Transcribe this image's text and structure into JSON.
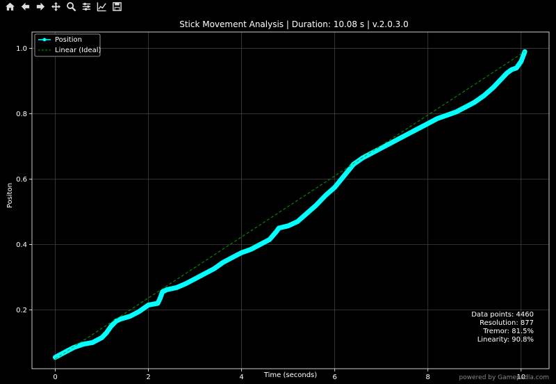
{
  "toolbar": {
    "buttons": [
      "home-icon",
      "back-icon",
      "forward-icon",
      "pan-icon",
      "zoom-icon",
      "configure-icon",
      "edit-axis-icon",
      "save-icon"
    ]
  },
  "chart_data": {
    "type": "line",
    "title": "Stick Movement Analysis | Duration: 10.08 s | v.2.0.3.0",
    "xlabel": "Time (seconds)",
    "ylabel": "Positon",
    "xlim": [
      -0.5,
      10.6
    ],
    "ylim": [
      0.02,
      1.05
    ],
    "xticks": [
      0,
      2,
      4,
      6,
      8,
      10
    ],
    "xtick_labels": [
      "0",
      "2",
      "4",
      "6",
      "8",
      "10"
    ],
    "yticks": [
      0.2,
      0.4,
      0.6,
      0.8,
      1.0
    ],
    "ytick_labels": [
      "0.2",
      "0.4",
      "0.6",
      "0.8",
      "1.0"
    ],
    "grid": true,
    "legend_position": "top-left",
    "series": [
      {
        "name": "Position",
        "color": "#00ffff",
        "style": "solid-with-markers",
        "x": [
          0,
          0.2,
          0.4,
          0.6,
          0.8,
          1.0,
          1.1,
          1.2,
          1.3,
          1.4,
          1.6,
          1.8,
          1.9,
          2.0,
          2.2,
          2.25,
          2.3,
          2.4,
          2.6,
          2.8,
          3.0,
          3.2,
          3.4,
          3.6,
          3.8,
          4.0,
          4.2,
          4.4,
          4.6,
          4.75,
          4.8,
          5.0,
          5.2,
          5.4,
          5.6,
          5.8,
          6.0,
          6.2,
          6.4,
          6.6,
          6.8,
          7.0,
          7.2,
          7.4,
          7.6,
          7.8,
          8.0,
          8.2,
          8.4,
          8.6,
          8.8,
          9.0,
          9.2,
          9.4,
          9.6,
          9.7,
          9.8,
          9.9,
          10.0,
          10.08
        ],
        "y": [
          0.055,
          0.07,
          0.085,
          0.095,
          0.1,
          0.115,
          0.13,
          0.15,
          0.165,
          0.172,
          0.18,
          0.195,
          0.205,
          0.215,
          0.22,
          0.235,
          0.255,
          0.262,
          0.268,
          0.28,
          0.295,
          0.31,
          0.325,
          0.345,
          0.36,
          0.375,
          0.385,
          0.4,
          0.415,
          0.44,
          0.45,
          0.457,
          0.47,
          0.495,
          0.52,
          0.55,
          0.575,
          0.61,
          0.645,
          0.665,
          0.68,
          0.695,
          0.71,
          0.725,
          0.74,
          0.755,
          0.77,
          0.785,
          0.795,
          0.805,
          0.82,
          0.835,
          0.855,
          0.88,
          0.91,
          0.925,
          0.935,
          0.94,
          0.96,
          0.99
        ]
      },
      {
        "name": "Linear (Ideal)",
        "color": "#00a000",
        "style": "dashed",
        "x": [
          0,
          10.08
        ],
        "y": [
          0.05,
          0.99
        ]
      }
    ],
    "annotations": [
      "Data points: 4460",
      "Resolution: 877",
      "Tremor: 81.5%",
      "Linearity: 90.8%"
    ]
  },
  "footer": {
    "watermark": "powered by Gamepadla.com"
  }
}
